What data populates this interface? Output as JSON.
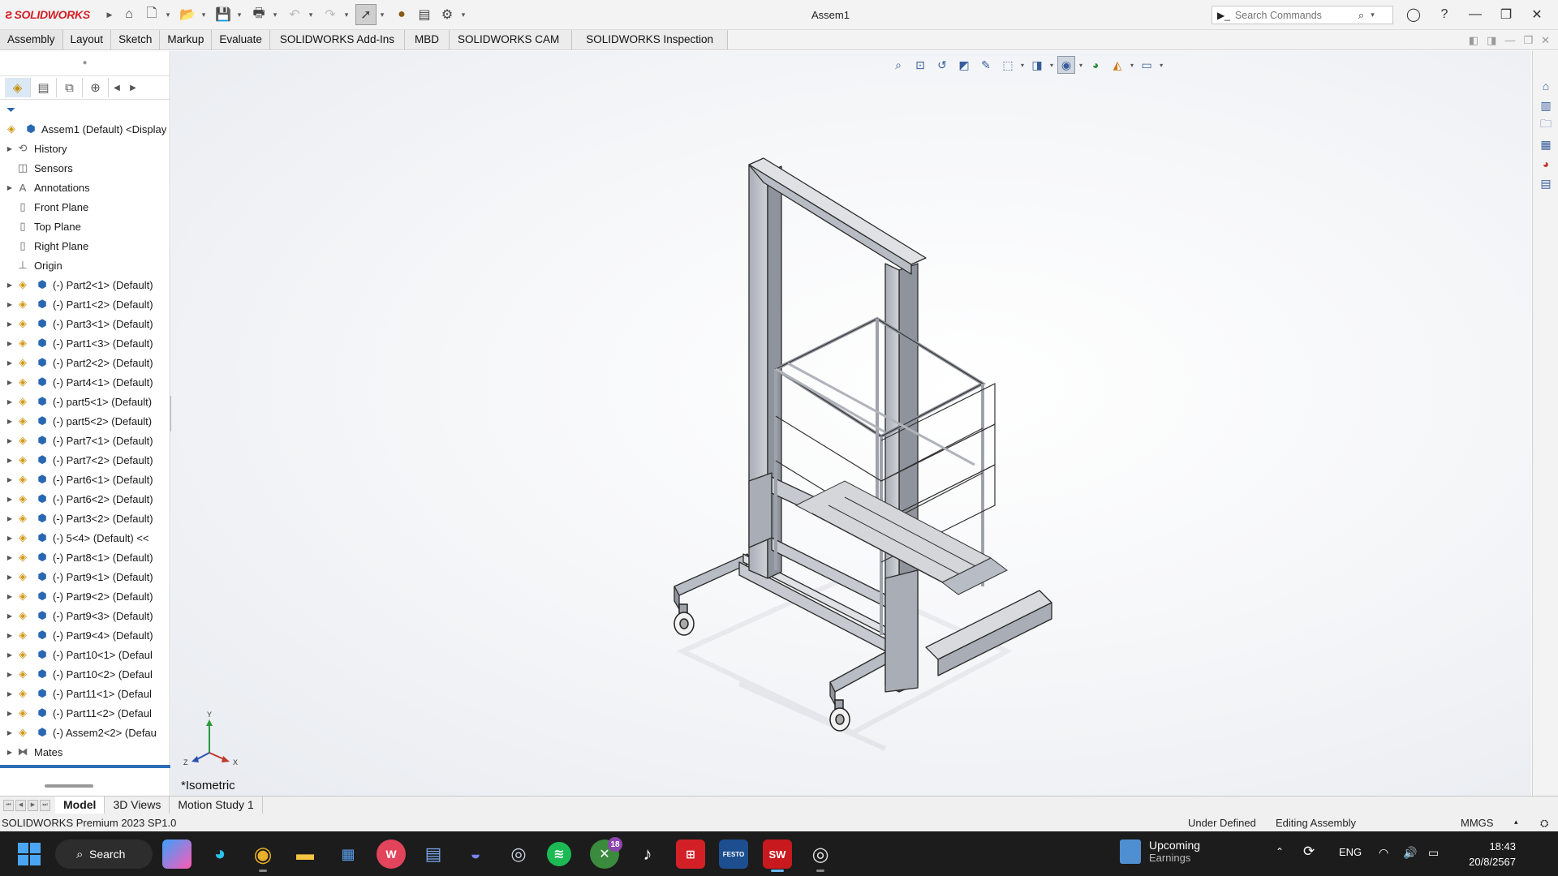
{
  "app": {
    "brand": "SOLIDWORKS",
    "document_title": "Assem1"
  },
  "search": {
    "placeholder": "Search Commands"
  },
  "command_tabs": [
    "Assembly",
    "Layout",
    "Sketch",
    "Markup",
    "Evaluate",
    "SOLIDWORKS Add-Ins",
    "MBD",
    "SOLIDWORKS CAM",
    "SOLIDWORKS Inspection"
  ],
  "feature_tree": {
    "root": "Assem1 (Default) <Display",
    "items": [
      {
        "label": "History",
        "icon": "history-icon",
        "expand": true
      },
      {
        "label": "Sensors",
        "icon": "sensors-icon",
        "expand": false
      },
      {
        "label": "Annotations",
        "icon": "annotations-icon",
        "expand": true
      },
      {
        "label": "Front Plane",
        "icon": "plane-icon",
        "expand": false
      },
      {
        "label": "Top Plane",
        "icon": "plane-icon",
        "expand": false
      },
      {
        "label": "Right Plane",
        "icon": "plane-icon",
        "expand": false
      },
      {
        "label": "Origin",
        "icon": "origin-icon",
        "expand": false
      },
      {
        "label": "(-) Part2<1> (Default)",
        "icon": "part-icon",
        "expand": true
      },
      {
        "label": "(-) Part1<2> (Default)",
        "icon": "part-icon",
        "expand": true
      },
      {
        "label": "(-) Part3<1> (Default)",
        "icon": "part-icon",
        "expand": true
      },
      {
        "label": "(-) Part1<3> (Default)",
        "icon": "part-icon",
        "expand": true
      },
      {
        "label": "(-) Part2<2> (Default)",
        "icon": "part-icon",
        "expand": true
      },
      {
        "label": "(-) Part4<1> (Default)",
        "icon": "part-icon",
        "expand": true
      },
      {
        "label": "(-) part5<1> (Default)",
        "icon": "part-icon",
        "expand": true
      },
      {
        "label": "(-) part5<2> (Default)",
        "icon": "part-icon",
        "expand": true
      },
      {
        "label": "(-) Part7<1> (Default)",
        "icon": "part-icon",
        "expand": true
      },
      {
        "label": "(-) Part7<2> (Default)",
        "icon": "part-icon",
        "expand": true
      },
      {
        "label": "(-) Part6<1> (Default)",
        "icon": "part-icon",
        "expand": true
      },
      {
        "label": "(-) Part6<2> (Default)",
        "icon": "part-icon",
        "expand": true
      },
      {
        "label": "(-) Part3<2> (Default)",
        "icon": "part-icon",
        "expand": true
      },
      {
        "label": "(-) 5<4> (Default) <<",
        "icon": "part-icon",
        "expand": true
      },
      {
        "label": "(-) Part8<1> (Default)",
        "icon": "part-icon",
        "expand": true
      },
      {
        "label": "(-) Part9<1> (Default)",
        "icon": "part-icon",
        "expand": true
      },
      {
        "label": "(-) Part9<2> (Default)",
        "icon": "part-icon",
        "expand": true
      },
      {
        "label": "(-) Part9<3> (Default)",
        "icon": "part-icon",
        "expand": true
      },
      {
        "label": "(-) Part9<4> (Default)",
        "icon": "part-icon",
        "expand": true
      },
      {
        "label": "(-) Part10<1> (Defaul",
        "icon": "part-icon",
        "expand": true
      },
      {
        "label": "(-) Part10<2> (Defaul",
        "icon": "part-icon",
        "expand": true
      },
      {
        "label": "(-) Part11<1> (Defaul",
        "icon": "part-icon",
        "expand": true
      },
      {
        "label": "(-) Part11<2> (Defaul",
        "icon": "part-icon",
        "expand": true
      },
      {
        "label": "(-) Assem2<2> (Defau",
        "icon": "subassembly-icon",
        "expand": true
      },
      {
        "label": "Mates",
        "icon": "mates-icon",
        "expand": true
      }
    ]
  },
  "viewport": {
    "view_name": "*Isometric",
    "triad": {
      "y": "Y",
      "x": "X",
      "z": "Z"
    }
  },
  "bottom_tabs": [
    "Model",
    "3D Views",
    "Motion Study 1"
  ],
  "status": {
    "product": "SOLIDWORKS Premium 2023 SP1.0",
    "definition": "Under Defined",
    "mode": "Editing Assembly",
    "units": "MMGS"
  },
  "taskbar": {
    "search_label": "Search",
    "widget_title": "Upcoming",
    "widget_subtitle": "Earnings",
    "language": "ENG",
    "time": "18:43",
    "date": "20/8/2567",
    "badge_count": "18",
    "accent": "#4aa6f2"
  },
  "colors": {
    "brand_red": "#d32027",
    "tree_selection_blue": "#2a6fb8",
    "model_gray": "#b8bcc4"
  }
}
